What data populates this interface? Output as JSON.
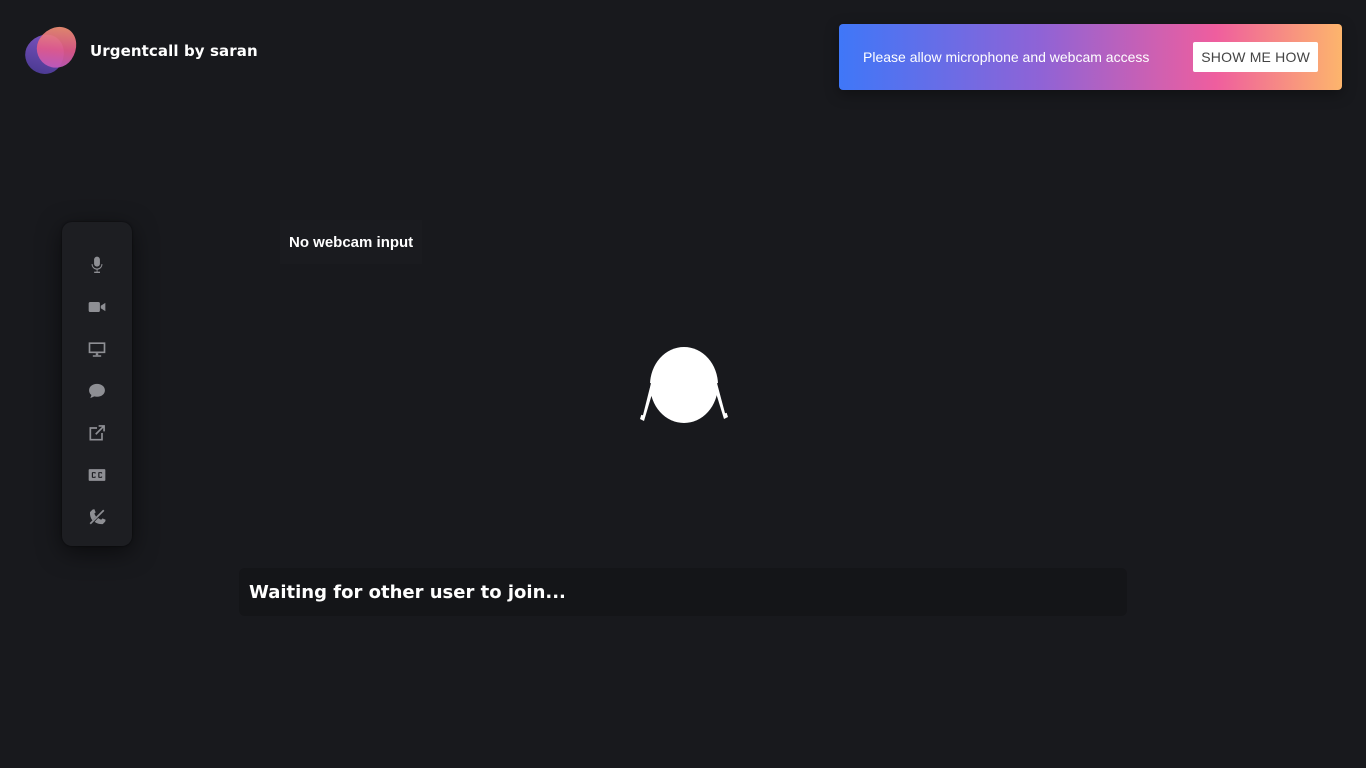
{
  "brand": {
    "title": "Urgentcall by saran",
    "logo_icon": "urgentcall-logo-icon"
  },
  "permission_banner": {
    "message": "Please allow microphone and webcam access",
    "button_label": "SHOW ME HOW",
    "gradient_colors": [
      "#3f77f8",
      "#8f63d6",
      "#ef5e9e",
      "#fdb56c"
    ]
  },
  "toolbar": {
    "items": [
      {
        "icon": "microphone-icon"
      },
      {
        "icon": "video-camera-icon"
      },
      {
        "icon": "screen-share-icon"
      },
      {
        "icon": "chat-icon"
      },
      {
        "icon": "external-link-icon"
      },
      {
        "icon": "closed-captions-icon"
      },
      {
        "icon": "end-call-icon"
      }
    ]
  },
  "video": {
    "webcam_status": "No webcam input",
    "avatar_icon": "user-avatar-icon"
  },
  "status": {
    "waiting_text": "Waiting for other user to join..."
  },
  "colors": {
    "background": "#18191d",
    "toolbar_bg": "#1d1e22",
    "icon_gray": "#8e8f94"
  }
}
